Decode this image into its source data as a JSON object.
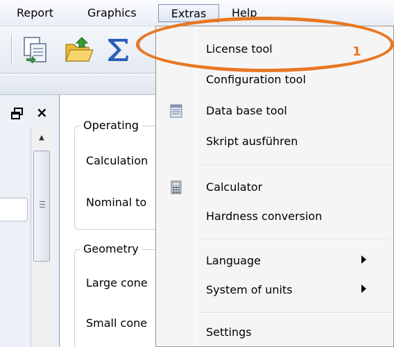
{
  "menubar": {
    "items": [
      {
        "label": "Report"
      },
      {
        "label": "Graphics"
      },
      {
        "label": "Extras"
      },
      {
        "label": "Help"
      }
    ]
  },
  "toolbar": {
    "icons": [
      "copy-icon",
      "open-folder-icon",
      "sum-icon"
    ]
  },
  "panel": {
    "close_label": "×",
    "scroll_up": "▲"
  },
  "content": {
    "operating_group": {
      "legend": "Operating",
      "labels": [
        "Calculation",
        "Nominal to"
      ]
    },
    "geometry_group": {
      "legend": "Geometry",
      "labels": [
        "Large cone",
        "Small cone"
      ]
    }
  },
  "extras_menu": {
    "items": [
      {
        "label": "License tool"
      },
      {
        "label": "Configuration tool"
      },
      {
        "label": "Data base tool",
        "icon": "database-icon"
      },
      {
        "label": "Skript ausführen"
      },
      {
        "label": "Calculator",
        "icon": "calculator-icon"
      },
      {
        "label": "Hardness conversion"
      },
      {
        "label": "Language",
        "submenu": true
      },
      {
        "label": "System of units",
        "submenu": true
      },
      {
        "label": "Settings"
      }
    ]
  },
  "annotation": {
    "callout_number": "1",
    "color": "#e87722"
  }
}
